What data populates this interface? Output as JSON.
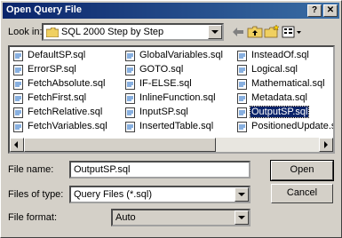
{
  "window": {
    "title": "Open Query File",
    "help_label": "?",
    "close_label": "✕"
  },
  "lookin": {
    "label": "Look in:",
    "value": "SQL 2000 Step by Step"
  },
  "toolbar": {
    "icons": [
      "back-icon",
      "up-folder-icon",
      "new-folder-icon",
      "view-menu-icon"
    ]
  },
  "files": {
    "columns": [
      [
        "DefaultSP.sql",
        "ErrorSP.sql",
        "FetchAbsolute.sql",
        "FetchFirst.sql",
        "FetchRelative.sql",
        "FetchVariables.sql"
      ],
      [
        "GlobalVariables.sql",
        "GOTO.sql",
        "IF-ELSE.sql",
        "InlineFunction.sql",
        "InputSP.sql",
        "InsertedTable.sql"
      ],
      [
        "InsteadOf.sql",
        "Logical.sql",
        "Mathematical.sql",
        "Metadata.sql",
        "OutputSP.sql",
        "PositionedUpdate.sql"
      ]
    ],
    "selected": "OutputSP.sql"
  },
  "filename": {
    "label": "File name:",
    "value": "OutputSP.sql"
  },
  "filetype": {
    "label": "Files of type:",
    "value": "Query Files (*.sql)"
  },
  "fileformat": {
    "label": "File format:",
    "value": "Auto"
  },
  "buttons": {
    "open": "Open",
    "cancel": "Cancel"
  },
  "colors": {
    "titlebar": "#0a246a",
    "selection": "#0a246a",
    "face": "#d4d0c8"
  }
}
